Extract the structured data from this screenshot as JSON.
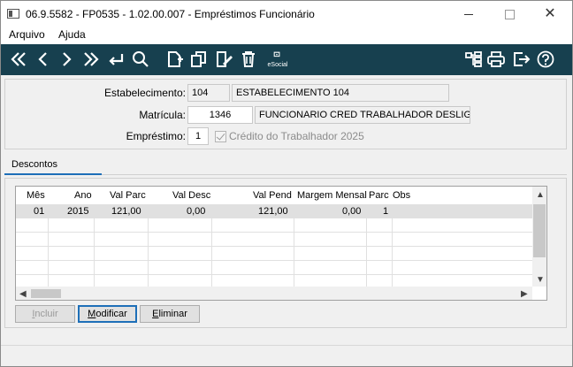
{
  "window": {
    "title": "06.9.5582 - FP0535 - 1.02.00.007 - Empréstimos Funcionário",
    "close_glyph": "✕"
  },
  "menu": {
    "items": [
      "Arquivo",
      "Ajuda"
    ]
  },
  "toolbar": {
    "icons": [
      "first-icon",
      "previous-icon",
      "next-icon",
      "last-icon",
      "return-icon",
      "search-icon",
      "new-icon",
      "copy-icon",
      "edit-icon",
      "delete-icon",
      "esocial-icon",
      "tree-icon",
      "print-icon",
      "exit-icon",
      "help-icon"
    ],
    "esocial_label": "eSocial",
    "bg_color": "#17404f"
  },
  "form": {
    "estabelecimento": {
      "label": "Estabelecimento:",
      "code": "104",
      "name": "ESTABELECIMENTO 104"
    },
    "matricula": {
      "label": "Matrícula:",
      "code": "1346",
      "name": "FUNCIONARIO CRED TRABALHADOR DESLIGADO"
    },
    "emprestimo": {
      "label": "Empréstimo:",
      "value": "1"
    },
    "credito": {
      "label": "Crédito do Trabalhador 2025",
      "checked": true
    }
  },
  "tabs": [
    {
      "label": "Descontos",
      "active": true
    }
  ],
  "grid": {
    "columns": [
      "Mês",
      "Ano",
      "Val Parc",
      "Val Desc",
      "Val Pend",
      "Margem Mensal",
      "Parc",
      "Obs"
    ],
    "rows": [
      {
        "mes": "01",
        "ano": "2015",
        "val_parc": "121,00",
        "val_desc": "0,00",
        "val_pend": "121,00",
        "margem": "0,00",
        "parc": "1",
        "obs": ""
      }
    ]
  },
  "buttons": {
    "incluir": {
      "label_first": "I",
      "label_rest": "ncluir",
      "enabled": false
    },
    "modificar": {
      "label_first": "M",
      "label_rest": "odificar",
      "enabled": true
    },
    "eliminar": {
      "label_first": "E",
      "label_rest": "liminar",
      "enabled": true
    }
  }
}
